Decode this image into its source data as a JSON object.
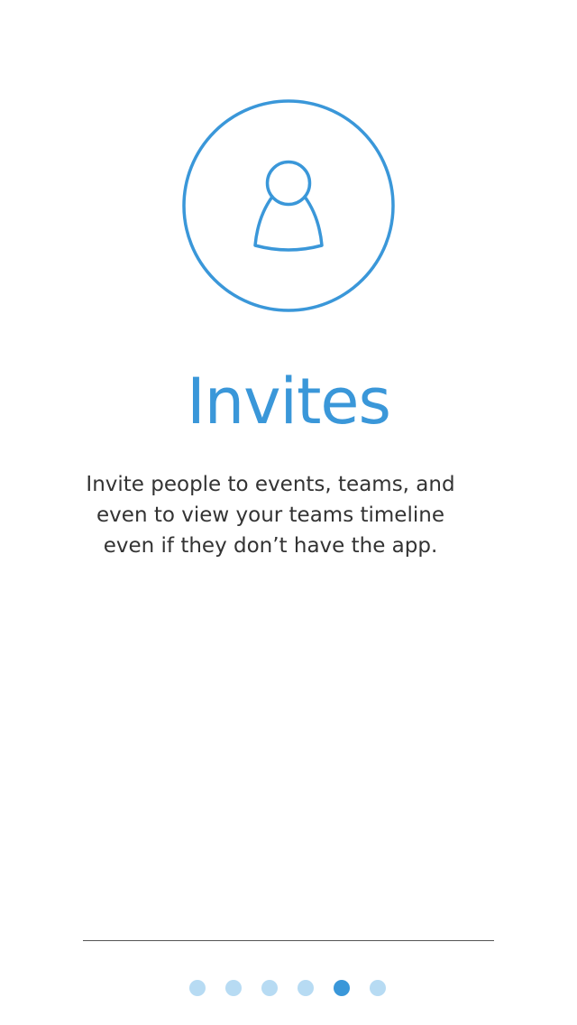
{
  "onboarding": {
    "icon": "person-icon",
    "title": "Invites",
    "description_lines": [
      "Invite people to events, teams, and",
      "even to view your teams timeline",
      "even if they don’t have the app."
    ]
  },
  "pagination": {
    "total_pages": 6,
    "current_page": 5
  },
  "colors": {
    "accent": "#3a97d9",
    "dot_inactive": "#b7dbf3",
    "text": "#333333",
    "divider": "#555555"
  }
}
